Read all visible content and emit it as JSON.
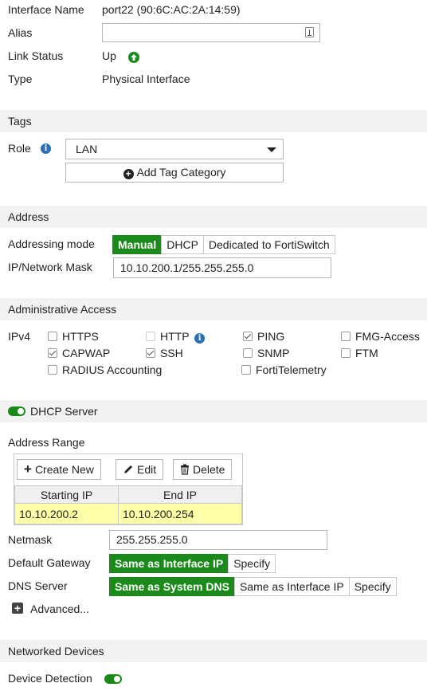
{
  "interface": {
    "name_label": "Interface Name",
    "name_value": "port22 (90:6C:AC:2A:14:59)",
    "alias_label": "Alias",
    "alias_value": "",
    "link_status_label": "Link Status",
    "link_status_value": "Up",
    "type_label": "Type",
    "type_value": "Physical Interface"
  },
  "tags": {
    "section_title": "Tags",
    "role_label": "Role",
    "role_value": "LAN",
    "add_tag_label": "Add Tag Category"
  },
  "address": {
    "section_title": "Address",
    "mode_label": "Addressing mode",
    "modes": [
      "Manual",
      "DHCP",
      "Dedicated to FortiSwitch"
    ],
    "active_mode": "Manual",
    "ipmask_label": "IP/Network Mask",
    "ipmask_value": "10.10.200.1/255.255.255.0"
  },
  "admin_access": {
    "section_title": "Administrative Access",
    "ipv4_label": "IPv4",
    "options": [
      {
        "label": "HTTPS",
        "checked": false,
        "disabled": false
      },
      {
        "label": "HTTP",
        "checked": false,
        "disabled": true
      },
      {
        "label": "PING",
        "checked": true,
        "disabled": false
      },
      {
        "label": "FMG-Access",
        "checked": false,
        "disabled": false
      },
      {
        "label": "CAPWAP",
        "checked": true,
        "disabled": false
      },
      {
        "label": "SSH",
        "checked": true,
        "disabled": false
      },
      {
        "label": "SNMP",
        "checked": false,
        "disabled": false
      },
      {
        "label": "FTM",
        "checked": false,
        "disabled": false
      },
      {
        "label": "RADIUS Accounting",
        "checked": false,
        "disabled": false
      },
      {
        "label": "FortiTelemetry",
        "checked": false,
        "disabled": false
      }
    ]
  },
  "dhcp": {
    "section_title": "DHCP Server",
    "enabled": true,
    "range_label": "Address Range",
    "create_new_label": "Create New",
    "edit_label": "Edit",
    "delete_label": "Delete",
    "columns": [
      "Starting IP",
      "End IP"
    ],
    "rows": [
      [
        "10.10.200.2",
        "10.10.200.254"
      ]
    ],
    "netmask_label": "Netmask",
    "netmask_value": "255.255.255.0",
    "gateway_label": "Default Gateway",
    "gateway_options": [
      "Same as Interface IP",
      "Specify"
    ],
    "gateway_active": "Same as Interface IP",
    "dns_label": "DNS Server",
    "dns_options": [
      "Same as System DNS",
      "Same as Interface IP",
      "Specify"
    ],
    "dns_active": "Same as System DNS",
    "advanced_label": "Advanced..."
  },
  "networked_devices": {
    "section_title": "Networked Devices",
    "device_detection_label": "Device Detection",
    "device_detection_enabled": true
  },
  "colors": {
    "accent_green": "#1a8a1a",
    "info_blue": "#2a6fb5",
    "section_bg": "#f2f2f2",
    "row_highlight": "#ffffa8"
  }
}
